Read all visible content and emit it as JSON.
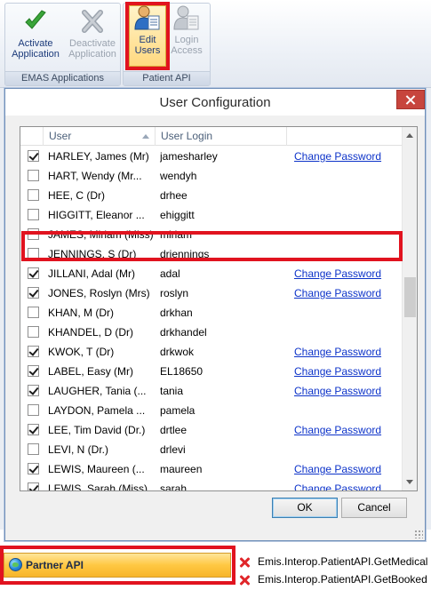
{
  "ribbon": {
    "groups": [
      {
        "label": "EMAS Applications",
        "buttons": [
          {
            "label_line1": "Activate",
            "label_line2": "Application",
            "icon": "green-check-icon",
            "enabled": true
          },
          {
            "label_line1": "Deactivate",
            "label_line2": "Application",
            "icon": "grey-x-icon",
            "enabled": false
          }
        ]
      },
      {
        "label": "Patient API",
        "buttons": [
          {
            "label_line1": "Edit",
            "label_line2": "Users",
            "icon": "user-edit-icon",
            "enabled": true
          },
          {
            "label_line1": "Login",
            "label_line2": "Access",
            "icon": "user-key-icon",
            "enabled": false
          }
        ]
      }
    ]
  },
  "dialog": {
    "title": "User Configuration",
    "columns": [
      "User",
      "User Login"
    ],
    "change_password_label": "Change Password",
    "rows": [
      {
        "user": "HARLEY, James (Mr)",
        "login": "jamesharley",
        "checked": true,
        "has_link": true
      },
      {
        "user": "HART, Wendy (Mr...",
        "login": "wendyh",
        "checked": false,
        "has_link": false
      },
      {
        "user": "HEE, C (Dr)",
        "login": "drhee",
        "checked": false,
        "has_link": false
      },
      {
        "user": "HIGGITT, Eleanor ...",
        "login": "ehiggitt",
        "checked": false,
        "has_link": false
      },
      {
        "user": "JAMES, Miriam (Miss)",
        "login": "miriam",
        "checked": false,
        "has_link": false
      },
      {
        "user": "JENNINGS, S (Dr)",
        "login": "drjennings",
        "checked": false,
        "has_link": false
      },
      {
        "user": "JILLANI, Adal (Mr)",
        "login": "adal",
        "checked": true,
        "has_link": true
      },
      {
        "user": "JONES, Roslyn (Mrs)",
        "login": "roslyn",
        "checked": true,
        "has_link": true
      },
      {
        "user": "KHAN, M (Dr)",
        "login": "drkhan",
        "checked": false,
        "has_link": false
      },
      {
        "user": "KHANDEL, D (Dr)",
        "login": "drkhandel",
        "checked": false,
        "has_link": false
      },
      {
        "user": "KWOK, T (Dr)",
        "login": "drkwok",
        "checked": true,
        "has_link": true
      },
      {
        "user": "LABEL, Easy (Mr)",
        "login": "EL18650",
        "checked": true,
        "has_link": true
      },
      {
        "user": "LAUGHER, Tania (...",
        "login": "tania",
        "checked": true,
        "has_link": true
      },
      {
        "user": "LAYDON, Pamela ...",
        "login": "pamela",
        "checked": false,
        "has_link": false
      },
      {
        "user": "LEE, Tim David (Dr.)",
        "login": "drtlee",
        "checked": true,
        "has_link": true
      },
      {
        "user": "LEVI, N (Dr.)",
        "login": "drlevi",
        "checked": false,
        "has_link": false
      },
      {
        "user": "LEWIS, Maureen (...",
        "login": "maureen",
        "checked": true,
        "has_link": true
      },
      {
        "user": "LEWIS, Sarah (Miss)",
        "login": "sarah",
        "checked": true,
        "has_link": true
      }
    ],
    "ok_label": "OK",
    "cancel_label": "Cancel"
  },
  "background": {
    "partner_label": "Partner API",
    "list_items": [
      "Emis.Interop.PatientAPI.GetMedical",
      "Emis.Interop.PatientAPI.GetBooked"
    ]
  },
  "colors": {
    "highlight": "#e1131f",
    "link": "#0d33c9",
    "partner_accent": "#ffc843"
  }
}
